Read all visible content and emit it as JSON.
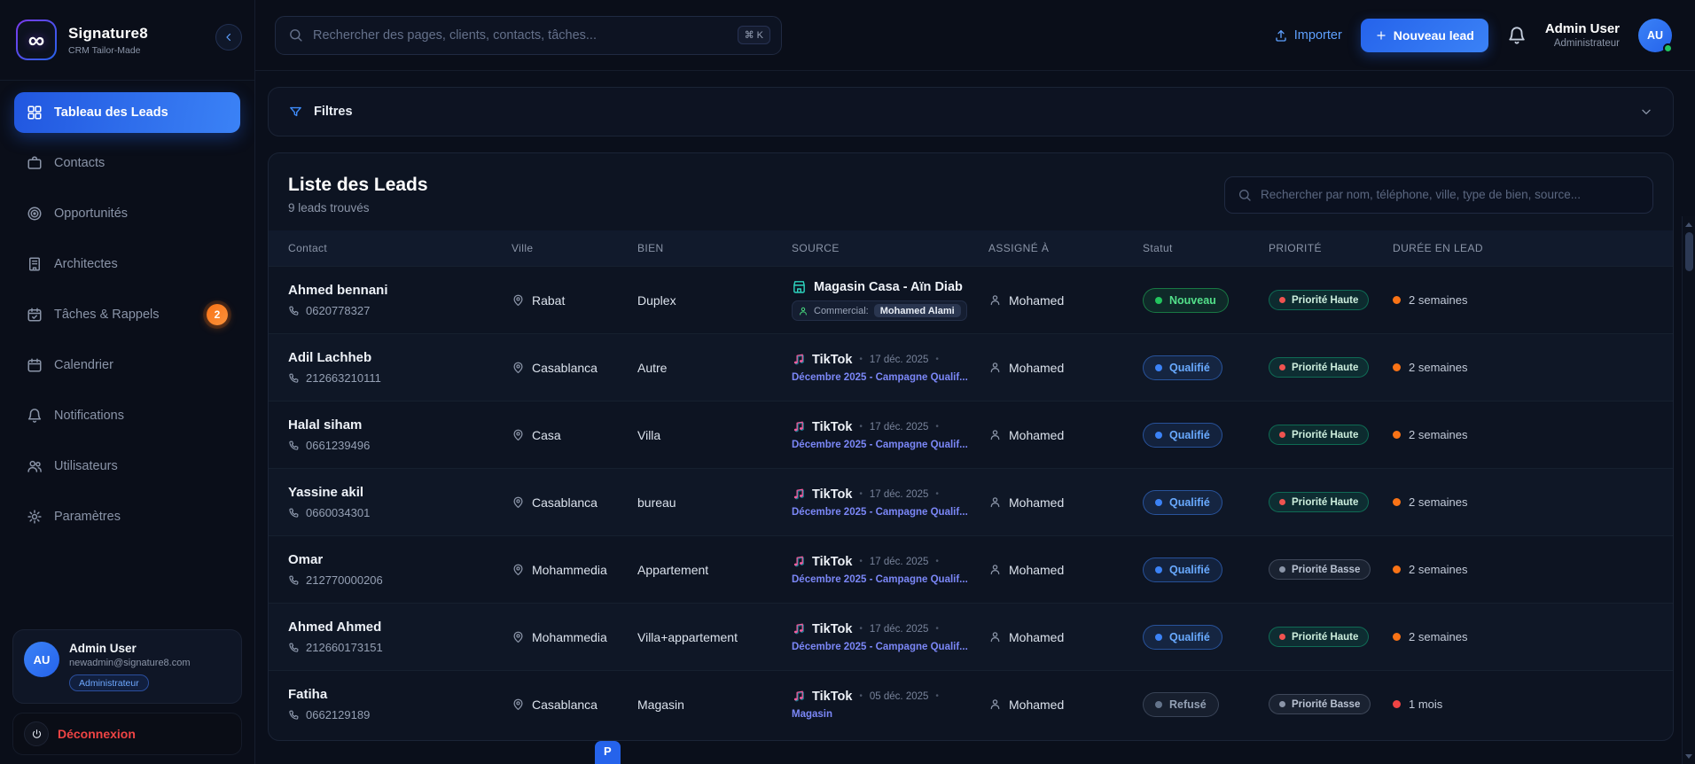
{
  "brand": {
    "name": "Signature8",
    "tagline": "CRM Tailor-Made",
    "logo_glyph": "∞"
  },
  "header": {
    "search_placeholder": "Rechercher des pages, clients, contacts, tâches...",
    "shortcut": "⌘ K",
    "importer_label": "Importer",
    "new_lead_label": "Nouveau lead",
    "user_name": "Admin User",
    "user_role": "Administrateur",
    "avatar_initials": "AU"
  },
  "sidebar": {
    "items": [
      {
        "label": "Tableau des Leads",
        "icon": "dashboard-icon",
        "active": true
      },
      {
        "label": "Contacts",
        "icon": "contacts-icon"
      },
      {
        "label": "Opportunités",
        "icon": "target-icon"
      },
      {
        "label": "Architectes",
        "icon": "building-icon"
      },
      {
        "label": "Tâches & Rappels",
        "icon": "tasks-icon",
        "badge": "2"
      },
      {
        "label": "Calendrier",
        "icon": "calendar-icon"
      },
      {
        "label": "Notifications",
        "icon": "bell-icon"
      },
      {
        "label": "Utilisateurs",
        "icon": "users-icon"
      },
      {
        "label": "Paramètres",
        "icon": "gear-icon"
      }
    ],
    "user": {
      "initials": "AU",
      "name": "Admin User",
      "email": "newadmin@signature8.com",
      "role_badge": "Administrateur"
    },
    "logout_label": "Déconnexion"
  },
  "filters": {
    "label": "Filtres"
  },
  "leads": {
    "title": "Liste des Leads",
    "count_text": "9 leads trouvés",
    "search_placeholder": "Rechercher par nom, téléphone, ville, type de bien, source...",
    "source_separator": "•",
    "columns": [
      "Contact",
      "Ville",
      "BIEN",
      "SOURCE",
      "ASSIGNÉ À",
      "Statut",
      "PRIORITÉ",
      "DURÉE EN LEAD"
    ],
    "rows": [
      {
        "name": "Ahmed bennani",
        "phone": "0620778327",
        "ville": "Rabat",
        "bien": "Duplex",
        "source": {
          "type": "magasin",
          "title": "Magasin Casa - Aïn Diab",
          "commercial_label": "Commercial:",
          "commercial_value": "Mohamed Alami"
        },
        "assignee": "Mohamed",
        "statut": {
          "label": "Nouveau",
          "variant": "nouveau"
        },
        "priorite": {
          "label": "Priorité Haute",
          "variant": "haute"
        },
        "duree": {
          "label": "2 semaines",
          "variant": "orange"
        }
      },
      {
        "name": "Adil Lachheb",
        "phone": "212663210111",
        "ville": "Casablanca",
        "bien": "Autre",
        "source": {
          "type": "tiktok",
          "title": "TikTok",
          "date": "17 déc. 2025",
          "campaign": "Décembre 2025 - Campagne Qualif..."
        },
        "assignee": "Mohamed",
        "statut": {
          "label": "Qualifié",
          "variant": "qualifie"
        },
        "priorite": {
          "label": "Priorité Haute",
          "variant": "haute"
        },
        "duree": {
          "label": "2 semaines",
          "variant": "orange"
        }
      },
      {
        "name": "Halal siham",
        "phone": "0661239496",
        "ville": "Casa",
        "bien": "Villa",
        "source": {
          "type": "tiktok",
          "title": "TikTok",
          "date": "17 déc. 2025",
          "campaign": "Décembre 2025 - Campagne Qualif..."
        },
        "assignee": "Mohamed",
        "statut": {
          "label": "Qualifié",
          "variant": "qualifie"
        },
        "priorite": {
          "label": "Priorité Haute",
          "variant": "haute"
        },
        "duree": {
          "label": "2 semaines",
          "variant": "orange"
        }
      },
      {
        "name": "Yassine akil",
        "phone": "0660034301",
        "ville": "Casablanca",
        "bien": "bureau",
        "source": {
          "type": "tiktok",
          "title": "TikTok",
          "date": "17 déc. 2025",
          "campaign": "Décembre 2025 - Campagne Qualif..."
        },
        "assignee": "Mohamed",
        "statut": {
          "label": "Qualifié",
          "variant": "qualifie"
        },
        "priorite": {
          "label": "Priorité Haute",
          "variant": "haute"
        },
        "duree": {
          "label": "2 semaines",
          "variant": "orange"
        }
      },
      {
        "name": "Omar",
        "phone": "212770000206",
        "ville": "Mohammedia",
        "bien": "Appartement",
        "source": {
          "type": "tiktok",
          "title": "TikTok",
          "date": "17 déc. 2025",
          "campaign": "Décembre 2025 - Campagne Qualif..."
        },
        "assignee": "Mohamed",
        "statut": {
          "label": "Qualifié",
          "variant": "qualifie"
        },
        "priorite": {
          "label": "Priorité Basse",
          "variant": "basse"
        },
        "duree": {
          "label": "2 semaines",
          "variant": "orange"
        }
      },
      {
        "name": "Ahmed Ahmed",
        "phone": "212660173151",
        "ville": "Mohammedia",
        "bien": "Villa+appartement",
        "source": {
          "type": "tiktok",
          "title": "TikTok",
          "date": "17 déc. 2025",
          "campaign": "Décembre 2025 - Campagne Qualif..."
        },
        "assignee": "Mohamed",
        "statut": {
          "label": "Qualifié",
          "variant": "qualifie"
        },
        "priorite": {
          "label": "Priorité Haute",
          "variant": "haute"
        },
        "duree": {
          "label": "2 semaines",
          "variant": "orange"
        }
      },
      {
        "name": "Fatiha",
        "phone": "0662129189",
        "ville": "Casablanca",
        "bien": "Magasin",
        "source": {
          "type": "tiktok",
          "title": "TikTok",
          "date": "05 déc. 2025",
          "campaign": "Magasin"
        },
        "assignee": "Mohamed",
        "statut": {
          "label": "Refusé",
          "variant": "refuse"
        },
        "priorite": {
          "label": "Priorité Basse",
          "variant": "basse"
        },
        "duree": {
          "label": "1 mois",
          "variant": "red"
        }
      }
    ]
  },
  "floating_button": "P"
}
